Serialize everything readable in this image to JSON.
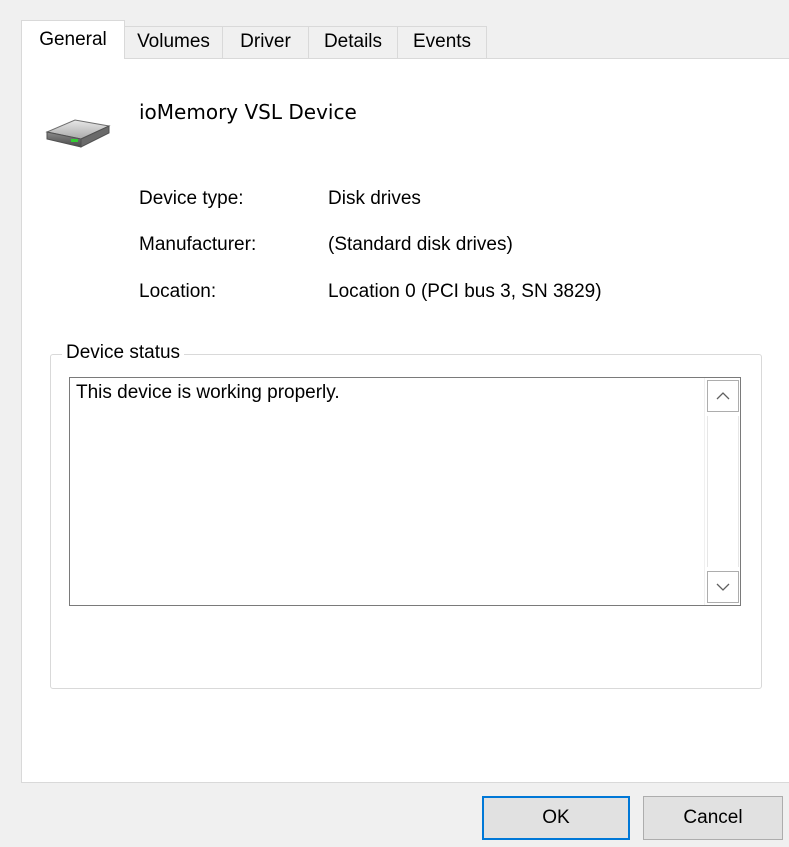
{
  "tabs": [
    {
      "label": "General",
      "active": true
    },
    {
      "label": "Volumes",
      "active": false
    },
    {
      "label": "Driver",
      "active": false
    },
    {
      "label": "Details",
      "active": false
    },
    {
      "label": "Events",
      "active": false
    }
  ],
  "device": {
    "icon": "hard-drive-icon",
    "name": "ioMemory VSL Device"
  },
  "properties": [
    {
      "label": "Device type:",
      "value": "Disk drives"
    },
    {
      "label": "Manufacturer:",
      "value": "(Standard disk drives)"
    },
    {
      "label": "Location:",
      "value": "Location 0 (PCI bus 3, SN 3829)"
    }
  ],
  "status_group": {
    "title": "Device status",
    "text": "This device is working properly."
  },
  "buttons": {
    "ok": "OK",
    "cancel": "Cancel"
  },
  "colors": {
    "focus_border": "#0078d7",
    "dialog_bg": "#f0f0f0",
    "panel_bg": "#ffffff"
  }
}
